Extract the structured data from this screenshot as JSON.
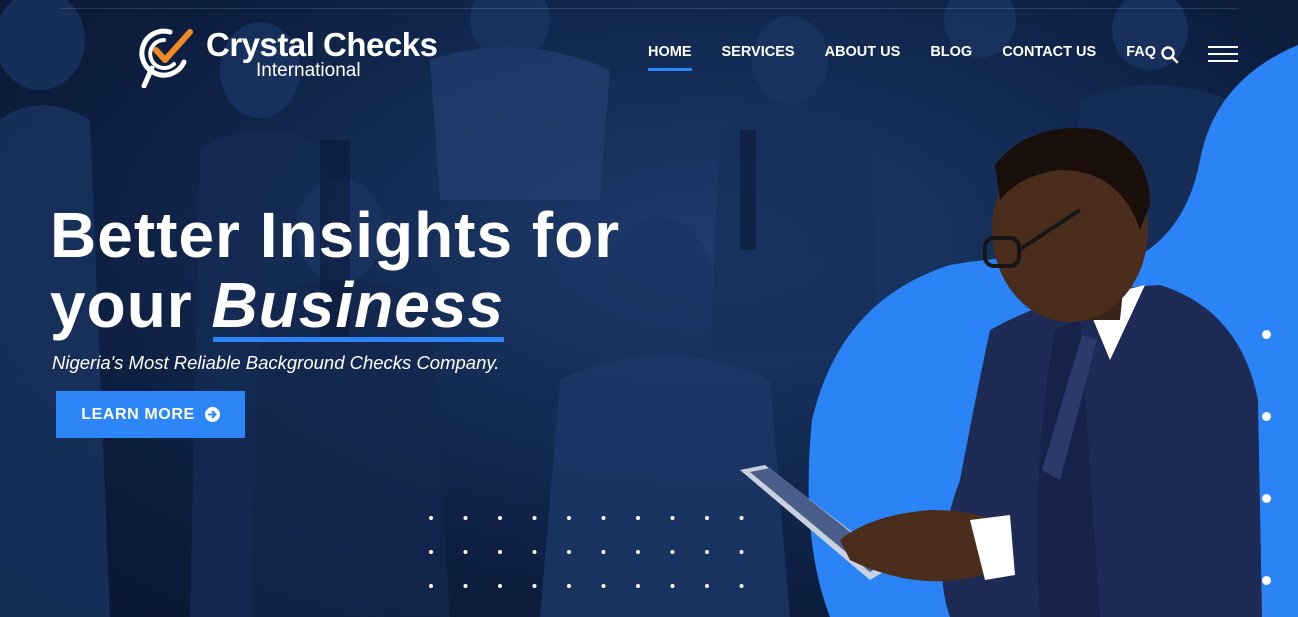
{
  "brand": {
    "name_line1": "Crystal Checks",
    "name_line2": "International",
    "colors": {
      "accent": "#2d86f7",
      "logo_orange": "#f08a24",
      "background": "#0c1d3d"
    }
  },
  "nav": {
    "items": [
      {
        "label": "HOME",
        "active": true
      },
      {
        "label": "SERVICES",
        "active": false
      },
      {
        "label": "ABOUT US",
        "active": false
      },
      {
        "label": "BLOG",
        "active": false
      },
      {
        "label": "CONTACT US",
        "active": false
      },
      {
        "label": "FAQ",
        "active": false
      }
    ],
    "search_icon": "search-icon",
    "menu_icon": "hamburger-menu-icon"
  },
  "hero": {
    "headline_line1": "Better Insights for",
    "headline_line2_plain": "your",
    "headline_line2_emphasis": "Business",
    "subtitle": "Nigeria's Most Reliable Background Checks Company.",
    "cta_label": "LEARN MORE",
    "cta_icon": "arrow-circle-right-icon"
  },
  "slider": {
    "dot_count": 4
  }
}
